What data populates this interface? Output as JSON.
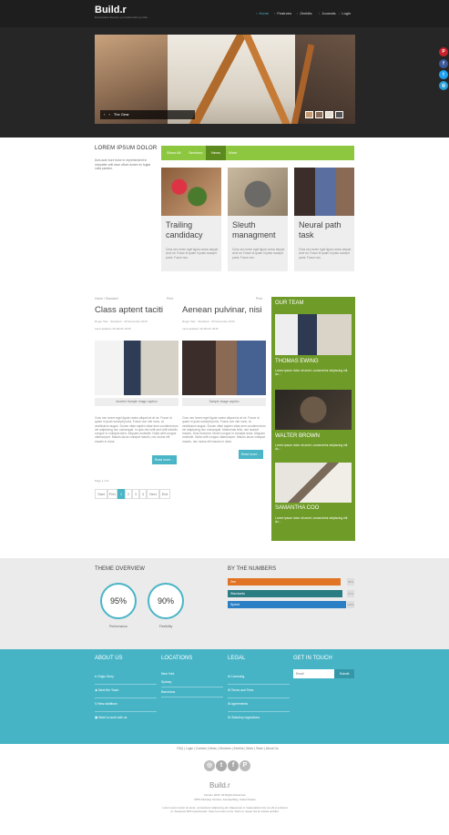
{
  "header": {
    "logo": "Build.r",
    "tagline": "Everywhere that are you build what you like...",
    "nav": [
      "Home",
      "Features",
      "Zenbits",
      "Journals",
      "Login"
    ]
  },
  "slider": {
    "caption": "The Gear",
    "prev": "‹",
    "next": "›"
  },
  "social": [
    "pinterest-icon",
    "facebook-icon",
    "twitter-icon",
    "instagram-icon"
  ],
  "lorem": {
    "title": "LOREM IPSUM DOLOR",
    "text": "Duis aute irure dolor in reprehenderit in voluptate velit esse cillum dolore eu fugiat nulla pariatur."
  },
  "tabs": [
    "Show All",
    "Services",
    "News",
    "Work"
  ],
  "active_tab": "News",
  "cards": [
    {
      "title": "Trailing candidacy",
      "text": "Criss nec lorem eget ligula varius aliquet at at mi. Fusce id quam in justo suscipit porta. Fusce non."
    },
    {
      "title": "Sleuth managment",
      "text": "Criss nec lorem eget ligula varius aliquet at at mi. Fusce id quam in justo suscipit porta. Fusce non."
    },
    {
      "title": "Neural path task",
      "text": "Criss nec lorem eget ligula varius aliquet at at mi. Fusce id quam in justo suscipit porta. Fusce non."
    }
  ],
  "posts": [
    {
      "crumb": "Home / Standard",
      "print": "Print",
      "title": "Class aptent taciti",
      "meta": "Roger Tate · Standard · 30 November 2015",
      "updated": "Last Updated: 30 March 2015",
      "caption": "Another Sample Image caption",
      "text": "Cras nec lorem eget ligula varius aliquet at at mi. Fusce id quam in justo suscipit porta. Fusce non nisl nunc, at vestibulum augue. Donec vitae sapien vitae sem condimentum vel adipiscing nec consequat. In quis nisi velit sed velit lobortis congue in volutpat dolor. Aliquam molestie. Nulla velit congue ullamcorper. Mauris lacus volutpat mauris, nec luctus elit mauris in dolor.",
      "readmore": "Read more ..."
    },
    {
      "crumb": "",
      "print": "Print",
      "title": "Aenean pulvinar, nisi",
      "meta": "Roger Tate · Standard · 30 November 2015",
      "updated": "Last Updated: 30 March 2015",
      "caption": "Sample Image caption",
      "text": "Cras nec lorem eget ligula varius aliquet at at mi. Fusce id quam in justo suscipit porta. Fusce non nisl nunc, at vestibulum augue. Donec vitae sapien vitae sem condimentum vel adipiscing nec consequat. Maecenas felis, nec laoreet mauris. Duis tincidunt. Morbi congue in volutpat dolor. Aliquam molestie. Nulla velit congue ullamcorper. Mauris lacus volutpat mauris, nec luctus elit mauris in dolor.",
      "readmore": "Read more ..."
    }
  ],
  "pagination": {
    "page_of": "Page 1 of 6",
    "items": [
      "Start",
      "Prev",
      "1",
      "2",
      "3",
      "4",
      "Next",
      "End"
    ]
  },
  "team": {
    "title": "OUR TEAM",
    "members": [
      {
        "name": "THOMAS EWING",
        "desc": "Lorem ipsum dolor sit amet, consectetur adipiscing elit. Ac..."
      },
      {
        "name": "WALTER BROWN",
        "desc": "Lorem ipsum dolor sit amet, consectetur adipiscing elit. Ac..."
      },
      {
        "name": "SAMANTHA COO",
        "desc": "Lorem ipsum dolor sit amet, consectetur adipiscing elit. Ac..."
      }
    ]
  },
  "overview": {
    "title": "THEME OVERVIEW",
    "circles": [
      {
        "value": "95%",
        "label": "Performance"
      },
      {
        "value": "90%",
        "label": "Flexibility"
      }
    ]
  },
  "numbers": {
    "title": "BY THE NUMBERS",
    "bars": [
      {
        "label": "Zen",
        "value": 95,
        "pct": "95%",
        "color": "#e07424"
      },
      {
        "label": "Standards",
        "value": 97,
        "pct": "97%",
        "color": "#2a7d83"
      },
      {
        "label": "Speed",
        "value": 100,
        "pct": "100%",
        "color": "#2b7fc4"
      }
    ]
  },
  "footer": {
    "about": {
      "title": "ABOUT US",
      "items": [
        "Origin Story",
        "Meet the Team",
        "New additions",
        "Want to work with us"
      ]
    },
    "locations": {
      "title": "LOCATIONS",
      "items": [
        "New York",
        "Sydney",
        "Barcelona"
      ]
    },
    "legal": {
      "title": "LEGAL",
      "items": [
        "Licensing",
        "Terms and Fees",
        "Agreements",
        "Statutory regulations"
      ]
    },
    "contact": {
      "title": "GET IN TOUCH",
      "placeholder": "Email",
      "submit": "Submit"
    }
  },
  "bottom": {
    "nav": "FAQ | Login | Contact | News | Services | Zenbits | Work | Team | About Us",
    "icons": [
      "dribbble-icon",
      "twitter-icon",
      "facebook-icon",
      "pinterest-icon"
    ],
    "logo": "Build.r",
    "copyright": "Version 2015. All Rights Reserved.",
    "address": "2875 Parkway Terrace, Kansas/Way, United States",
    "blurb": "Lorem ipsum dolor sit amet, consectetur adipiscing elit. Maecenas in malesuada tortor ac elit et pulvinar ut. Suspecet faith reprehender. Fauci et ovens ornis. Nunc ut neque dui at massa porttitor."
  }
}
